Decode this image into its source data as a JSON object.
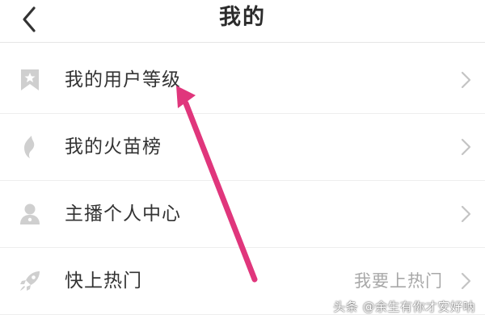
{
  "header": {
    "title": "我的"
  },
  "menu": {
    "items": [
      {
        "label": "我的用户等级",
        "value": "",
        "icon": "bookmark-star-icon"
      },
      {
        "label": "我的火苗榜",
        "value": "",
        "icon": "flame-icon"
      },
      {
        "label": "主播个人中心",
        "value": "",
        "icon": "user-icon"
      },
      {
        "label": "快上热门",
        "value": "我要上热门",
        "icon": "rocket-icon"
      }
    ]
  },
  "watermark": {
    "text": "头条 @余生有你才安好呐"
  },
  "colors": {
    "icon_gray": "#cfcfcf",
    "chevron_gray": "#c4c4c4",
    "annotation_arrow": "#e0367c",
    "text_primary": "#333333",
    "text_secondary": "#a8a8a8"
  }
}
